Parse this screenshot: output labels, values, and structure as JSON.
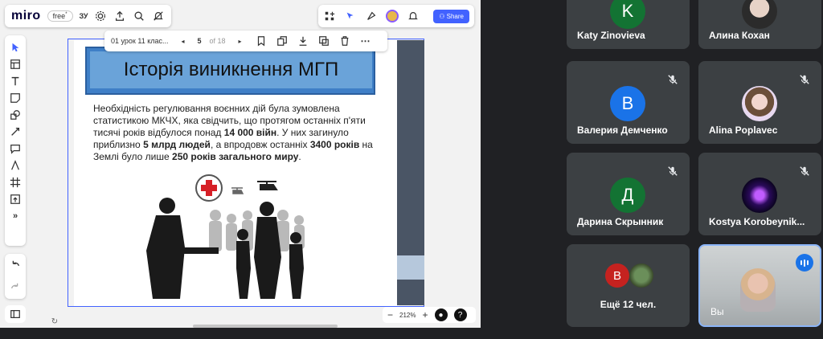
{
  "miro": {
    "logo": "miro",
    "plan_badge": "free",
    "plan_badge_sup": "*",
    "board_code": "ЗУ",
    "share_label": "Share",
    "slide_toolbar": {
      "file_name": "01 урок 11 клас...",
      "page_current": "5",
      "page_total": "of 18"
    },
    "zoom": "212%"
  },
  "slide": {
    "title": "Історія виникнення МГП",
    "body_parts": [
      {
        "t": "Необхідність регулювання воєнних дій була зумовлена статистикою МКЧХ, яка свідчить, що протягом останніх п'яти тисячі років відбулося понад ",
        "b": false
      },
      {
        "t": "14 000 війн",
        "b": true
      },
      {
        "t": ". У них загинуло приблизно ",
        "b": false
      },
      {
        "t": "5 млрд людей",
        "b": true
      },
      {
        "t": ", а впродовж останніх ",
        "b": false
      },
      {
        "t": "3400 років",
        "b": true
      },
      {
        "t": " на Землі було лише ",
        "b": false
      },
      {
        "t": "250 років загального миру",
        "b": true
      },
      {
        "t": ".",
        "b": false
      }
    ]
  },
  "participants": [
    {
      "name": "Katy Zinovieva",
      "initial": "K",
      "color": "#137333",
      "muted": false
    },
    {
      "name": "Алина Кохан",
      "initial": "",
      "color": "#9aa0a6",
      "muted": false
    },
    {
      "name": "Валерия Демченко",
      "initial": "В",
      "color": "#1a73e8",
      "muted": true
    },
    {
      "name": "Alina Poplavec",
      "initial": "",
      "color": "#c58af9",
      "muted": true
    },
    {
      "name": "Дарина Скрынник",
      "initial": "Д",
      "color": "#137333",
      "muted": true
    },
    {
      "name": "Kostya Korobeynik...",
      "initial": "",
      "color": "#3a1c71",
      "muted": true
    }
  ],
  "more_tile": {
    "label": "Ещё 12 чел.",
    "initial": "В",
    "color": "#c5221f"
  },
  "self_tile": {
    "label": "Вы",
    "accent": "#8ab4f8"
  }
}
